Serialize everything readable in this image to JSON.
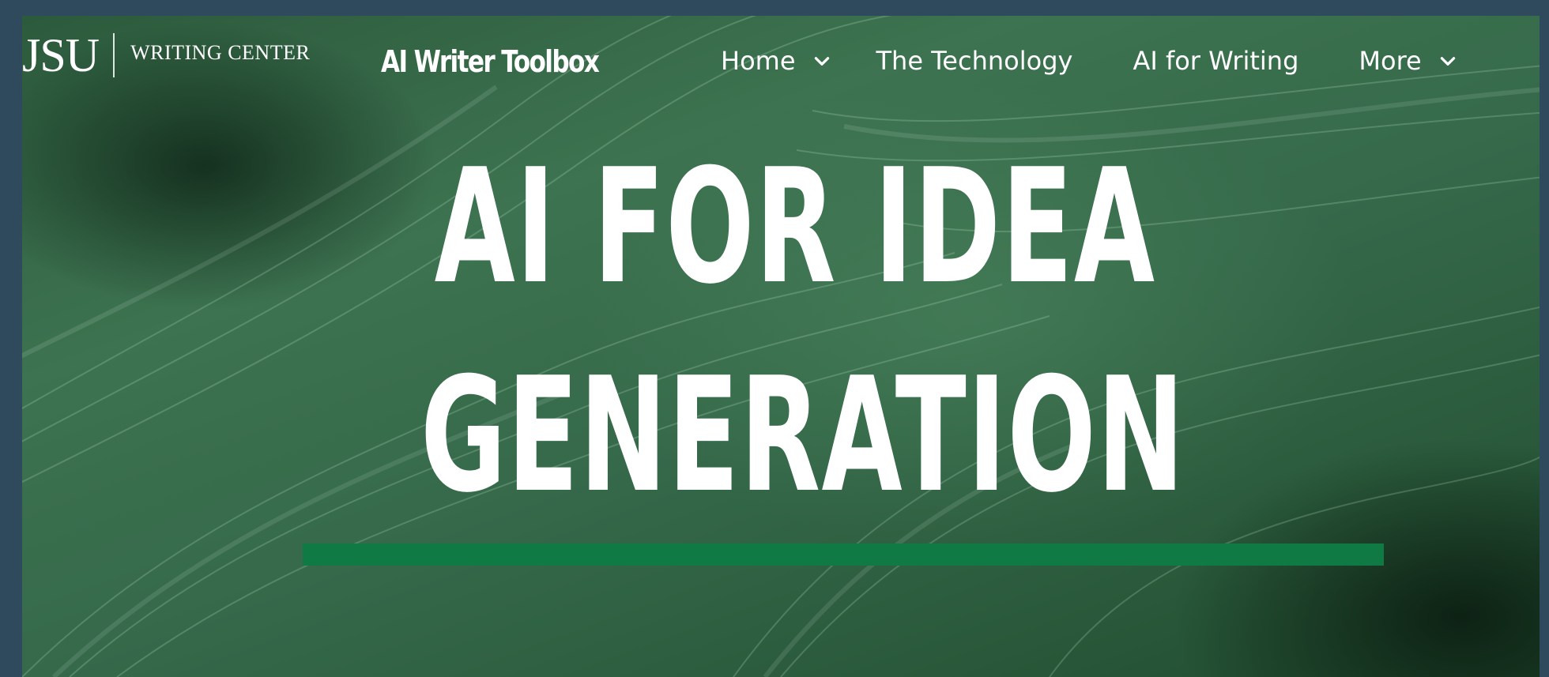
{
  "header": {
    "logo_mark": "JSU",
    "logo_subtitle": "WRITING CENTER",
    "site_title": "AI Writer Toolbox"
  },
  "nav": {
    "items": [
      {
        "label": "Home",
        "has_dropdown": true,
        "icon": "chevron-down-icon"
      },
      {
        "label": "The Technology",
        "has_dropdown": false
      },
      {
        "label": "AI for Writing",
        "has_dropdown": false
      },
      {
        "label": "More",
        "has_dropdown": true,
        "icon": "chevron-down-icon"
      }
    ]
  },
  "hero": {
    "title_line1": "AI FOR IDEA",
    "title_line2": "GENERATION",
    "accent_color": "#0f7a44"
  },
  "colors": {
    "background_green": "#35694a",
    "text": "#ffffff",
    "outer_frame": "#2e4a5c"
  }
}
